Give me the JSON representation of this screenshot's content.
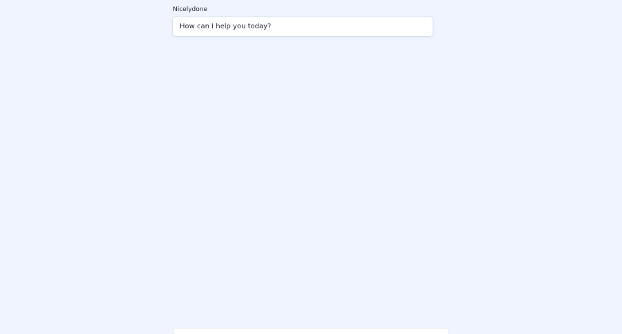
{
  "app": {
    "title": "Nicelydone"
  },
  "chat": {
    "messages": [
      {
        "text": "How can I help you today?"
      }
    ]
  },
  "composer": {
    "value": "",
    "placeholder": ""
  }
}
